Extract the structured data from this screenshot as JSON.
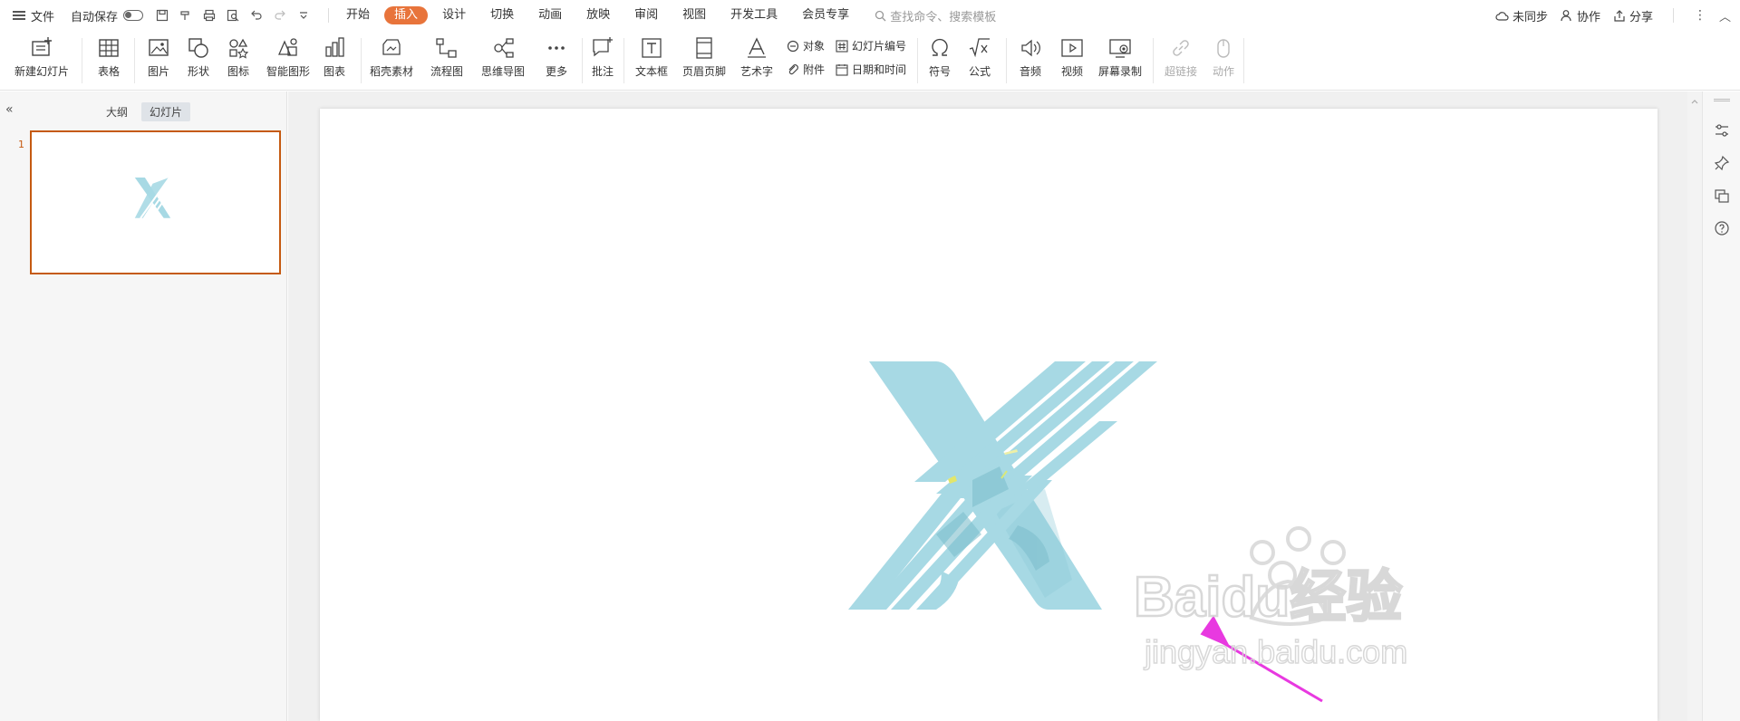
{
  "topbar": {
    "file_label": "文件",
    "autosave_label": "自动保存",
    "tabs": [
      {
        "label": "开始"
      },
      {
        "label": "插入"
      },
      {
        "label": "设计"
      },
      {
        "label": "切换"
      },
      {
        "label": "动画"
      },
      {
        "label": "放映"
      },
      {
        "label": "审阅"
      },
      {
        "label": "视图"
      },
      {
        "label": "开发工具"
      },
      {
        "label": "会员专享"
      }
    ],
    "active_tab": "插入",
    "search_placeholder": "查找命令、搜索模板",
    "sync_label": "未同步",
    "collab_label": "协作",
    "share_label": "分享"
  },
  "ribbon": {
    "new_slide": "新建幻灯片",
    "table": "表格",
    "picture": "图片",
    "shape": "形状",
    "icon": "图标",
    "smart_graphic": "智能图形",
    "chart": "图表",
    "docer_material": "稻壳素材",
    "flowchart": "流程图",
    "mindmap": "思维导图",
    "more": "更多",
    "comment": "批注",
    "textbox": "文本框",
    "header_footer": "页眉页脚",
    "wordart": "艺术字",
    "object": "对象",
    "attachment": "附件",
    "slide_number": "幻灯片编号",
    "date_time": "日期和时间",
    "symbol": "符号",
    "formula": "公式",
    "audio": "音频",
    "video": "视频",
    "screen_record": "屏幕录制",
    "hyperlink": "超链接",
    "action": "动作"
  },
  "left_panel": {
    "outline_tab": "大纲",
    "slides_tab": "幻灯片",
    "slide_number": "1"
  },
  "colors": {
    "accent": "#e8743b",
    "x_shape": "#a7d9e4",
    "arrow": "#e839e0",
    "thumb_border": "#c55a11"
  },
  "watermark": {
    "brand": "Baidu经验",
    "url": "jingyan.baidu.com"
  }
}
